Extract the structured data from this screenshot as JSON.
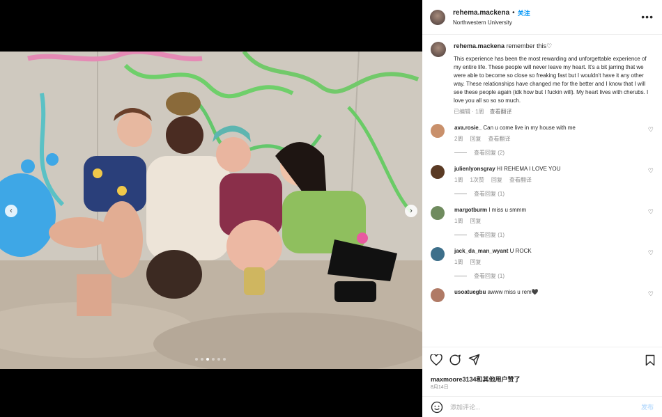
{
  "header": {
    "username": "rehema.mackena",
    "separator": "•",
    "follow_label": "关注",
    "location": "Northwestern University",
    "more_icon": "more-horizontal-icon"
  },
  "caption": {
    "username": "rehema.mackena",
    "title": "remember this♡",
    "text": "This experience has been the most rewarding and unforgettable experience of my entire life. These people will never leave my heart. It's a bit jarring that we were able to become so close so freaking fast but I wouldn't have it any other way. These relationships have changed me for the better and I know that I will see these people again (idk how but I fuckin will). My heart lives with cherubs. I love you all so so so much.",
    "edited": "已编辑 · 1周",
    "translate": "查看翻译"
  },
  "comments": [
    {
      "username": "ava.rosie_",
      "text": "Can u come live in my house with me",
      "time": "2周",
      "reply": "回复",
      "translate": "查看翻译",
      "replies": "查看回复 (2)",
      "avatar_color": "#c9906b"
    },
    {
      "username": "julienlyonsgray",
      "text": "HI REHEMA I LOVE YOU",
      "time": "1周",
      "likes": "1次赞",
      "reply": "回复",
      "translate": "查看翻译",
      "replies": "查看回复 (1)",
      "avatar_color": "#5a3a24"
    },
    {
      "username": "margotburm",
      "text": "I miss u smmm",
      "time": "1周",
      "reply": "回复",
      "replies": "查看回复 (1)",
      "avatar_color": "#6f8b5e"
    },
    {
      "username": "jack_da_man_wyant",
      "text": "U ROCK",
      "time": "1周",
      "reply": "回复",
      "replies": "查看回复 (1)",
      "avatar_color": "#3d6f8a"
    },
    {
      "username": "usoatuegbu",
      "text": "awww miss u rem🖤",
      "avatar_color": "#b07a66"
    }
  ],
  "actions": {
    "like_icon": "heart-icon",
    "comment_icon": "comment-icon",
    "share_icon": "send-icon",
    "save_icon": "bookmark-icon"
  },
  "likes_text": "maxmoore3134和其他用户赞了",
  "date": "8月14日",
  "add_comment": {
    "placeholder": "添加评论...",
    "post_label": "发布",
    "emoji_icon": "emoji-icon"
  },
  "carousel": {
    "prev_icon": "chevron-left-icon",
    "next_icon": "chevron-right-icon",
    "total_slides": 6,
    "active_slide": 3
  }
}
